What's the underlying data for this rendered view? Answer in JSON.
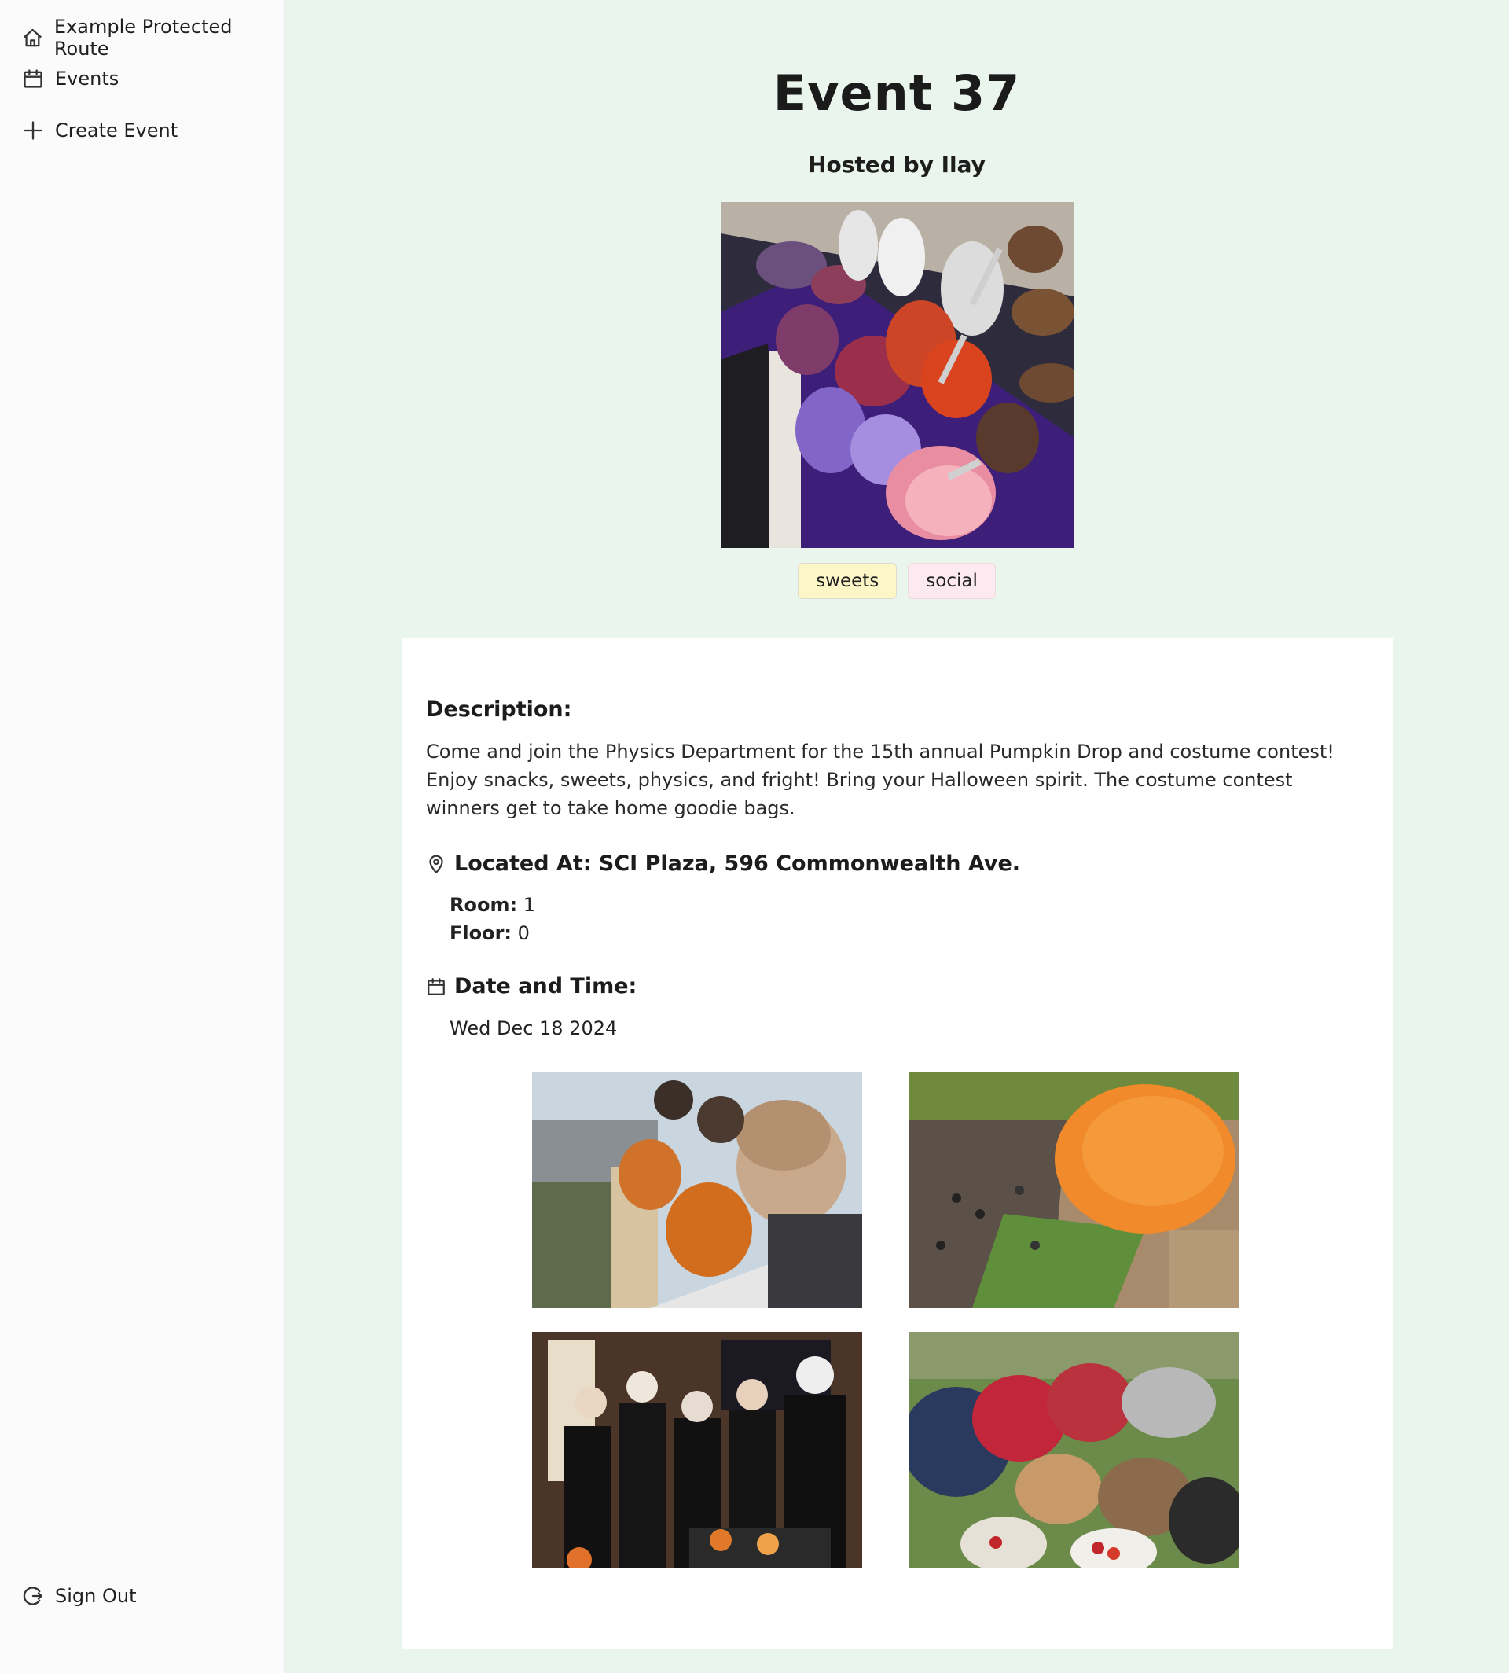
{
  "sidebar": {
    "items": [
      {
        "label": "Example Protected Route",
        "icon": "home-icon"
      },
      {
        "label": "Events",
        "icon": "calendar-icon"
      },
      {
        "label": "Create Event",
        "icon": "plus-icon"
      }
    ],
    "sign_out": {
      "label": "Sign Out",
      "icon": "sign-out-icon"
    }
  },
  "event": {
    "title": "Event 37",
    "host": "Hosted by Ilay",
    "tags": [
      "sweets",
      "social"
    ],
    "description_heading": "Description:",
    "description": "Come and join the Physics Department for the 15th annual Pumpkin Drop and costume contest! Enjoy snacks, sweets, physics, and fright! Bring your Halloween spirit. The costume contest winners get to take home goodie bags.",
    "location_heading": "Located At: SCI Plaza, 596 Commonwealth Ave.",
    "room_label": "Room:",
    "room_value": "1",
    "floor_label": "Floor:",
    "floor_value": "0",
    "date_heading": "Date and Time:",
    "date_value": "Wed Dec 18 2024"
  },
  "colors": {
    "page_background": "#eaf5ee",
    "sidebar_background": "#fbfbfb",
    "tag_sweets": "#fdf7c8",
    "tag_social": "#fdeaf0"
  }
}
